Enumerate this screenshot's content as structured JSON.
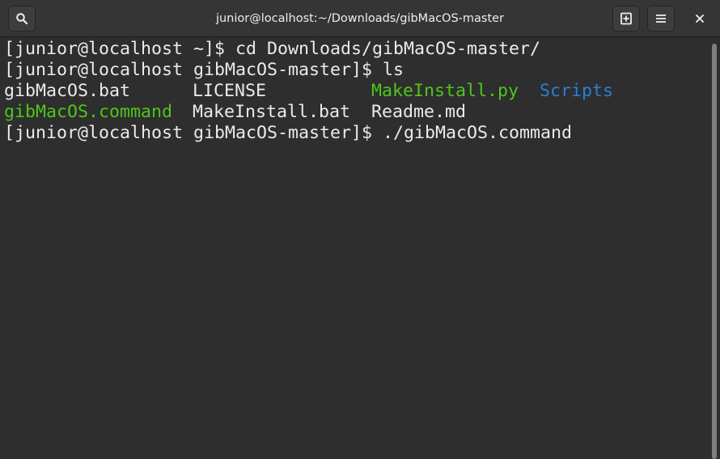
{
  "window": {
    "title": "junior@localhost:~/Downloads/gibMacOS-master"
  },
  "titlebar": {
    "search_icon": "search-icon",
    "new_tab_icon": "new-tab-icon",
    "menu_icon": "hamburger-menu-icon",
    "close_icon": "close-icon"
  },
  "colors": {
    "foreground": "#ebebeb",
    "executable": "#4ec619",
    "directory": "#2a7fd8",
    "background": "#2e2e2e"
  },
  "terminal": {
    "lines": [
      "[junior@localhost ~]$ cd Downloads/gibMacOS-master/",
      "[junior@localhost gibMacOS-master]$ ls",
      "[junior@localhost gibMacOS-master]$ ./gibMacOS.command"
    ],
    "ls_output": [
      [
        {
          "name": "gibMacOS.bat",
          "type": "file"
        },
        {
          "name": "LICENSE",
          "type": "file"
        },
        {
          "name": "MakeInstall.py",
          "type": "executable"
        },
        {
          "name": "Scripts",
          "type": "directory"
        }
      ],
      [
        {
          "name": "gibMacOS.command",
          "type": "executable"
        },
        {
          "name": "MakeInstall.bat",
          "type": "file"
        },
        {
          "name": "Readme.md",
          "type": "file"
        }
      ]
    ]
  }
}
